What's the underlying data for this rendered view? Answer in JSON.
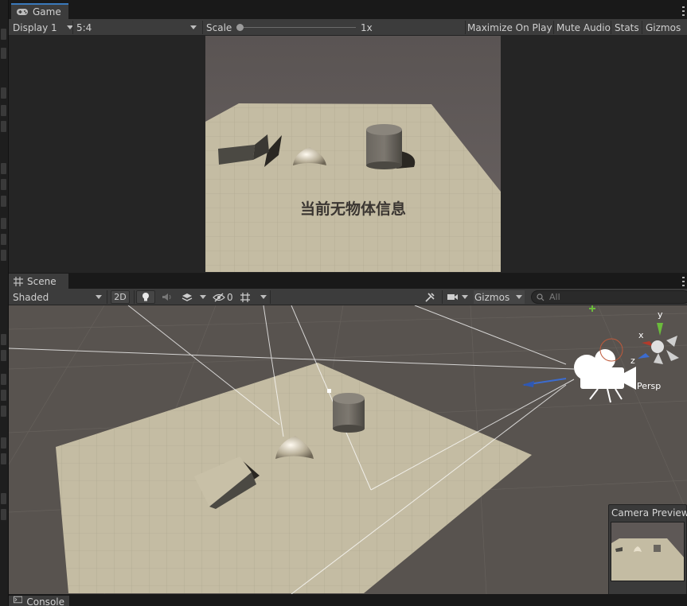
{
  "game_tab": {
    "icon": "gamepad-icon",
    "label": "Game"
  },
  "game_toolbar": {
    "display": "Display 1",
    "aspect": "5:4",
    "scale_label": "Scale",
    "scale_value": "1x",
    "maximize_on_play": "Maximize On Play",
    "mute_audio": "Mute Audio",
    "stats": "Stats",
    "gizmos": "Gizmos"
  },
  "game_overlay_text": "当前无物体信息",
  "scene_tab": {
    "icon": "grid-icon",
    "label": "Scene"
  },
  "scene_toolbar": {
    "shading_mode": "Shaded",
    "mode_2d": "2D",
    "hidden_count": "0",
    "gizmos": "Gizmos",
    "search_placeholder": "All"
  },
  "gizmo_axes": {
    "x": "x",
    "y": "y",
    "z": "z",
    "projection": "Persp"
  },
  "camera_preview": {
    "title": "Camera Preview"
  },
  "console_tab": {
    "label": "Console"
  },
  "colors": {
    "accent_tab": "#3a79bb",
    "toolbar": "#3c3c3c",
    "panel": "#191919",
    "floor": "#c4bca3"
  }
}
